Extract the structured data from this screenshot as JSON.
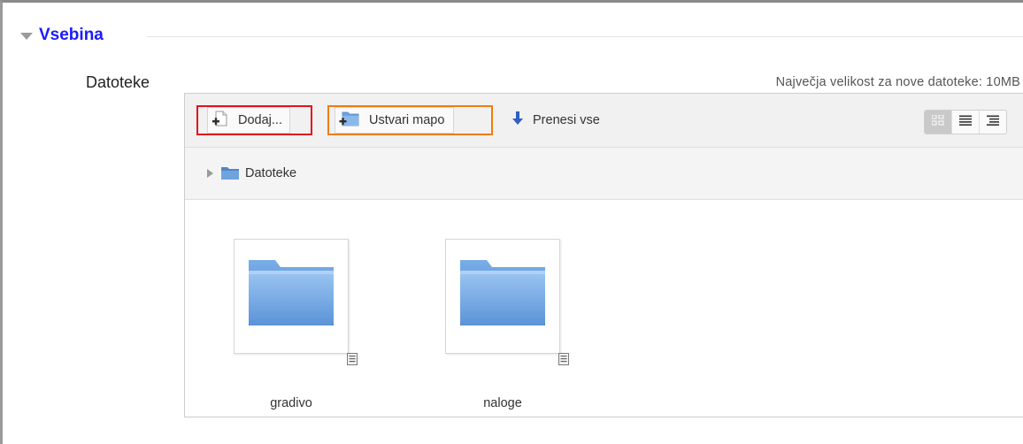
{
  "section": {
    "title": "Vsebina"
  },
  "field": {
    "label": "Datoteke",
    "max_size_text": "Največja velikost za nove datoteke: 10MB"
  },
  "toolbar": {
    "add_label": "Dodaj...",
    "mkdir_label": "Ustvari mapo",
    "download_all_label": "Prenesi vse",
    "view_modes": [
      "icons",
      "list",
      "tree"
    ],
    "active_view": "icons"
  },
  "path": {
    "items": [
      "Datoteke"
    ]
  },
  "files": [
    {
      "name": "gradivo",
      "type": "folder"
    },
    {
      "name": "naloge",
      "type": "folder"
    }
  ],
  "colors": {
    "legend_title": "#1a1aff",
    "add_highlight": "#e3121b",
    "mkdir_highlight": "#f07d0e",
    "folder_blue": "#6a9fdc"
  }
}
